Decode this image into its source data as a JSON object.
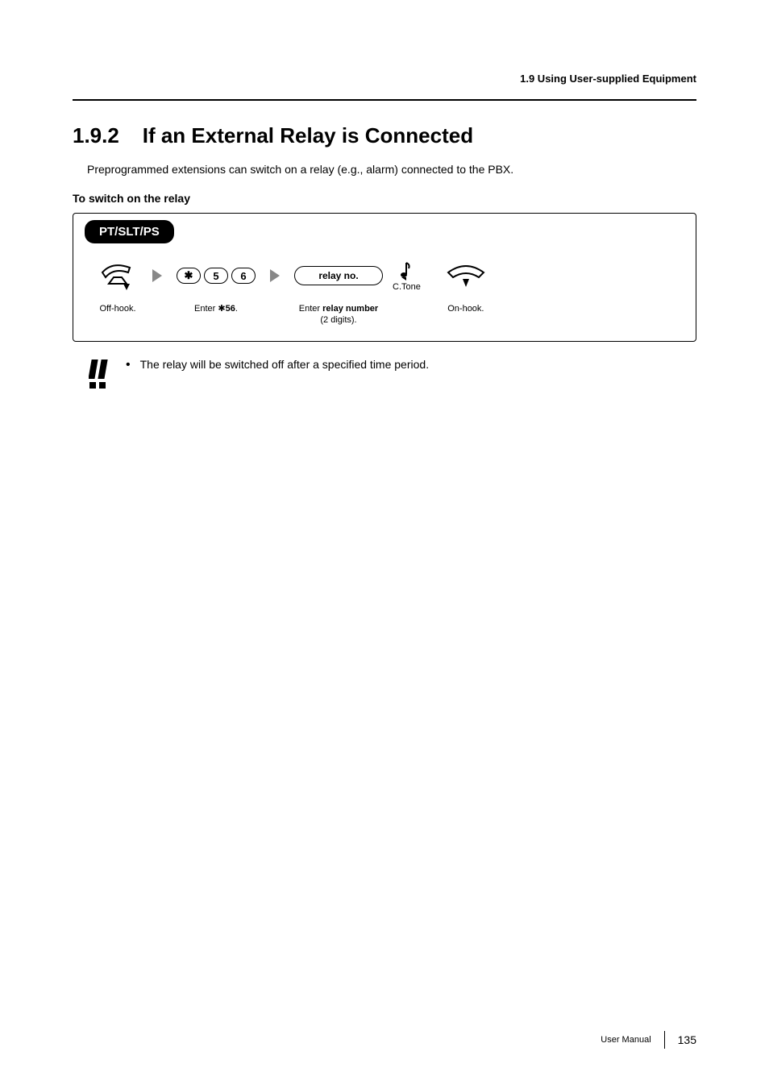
{
  "header": {
    "breadcrumb": "1.9 Using User-supplied Equipment"
  },
  "section": {
    "number": "1.9.2",
    "title": "If an External Relay is Connected"
  },
  "intro": "Preprogrammed extensions can switch on a relay (e.g., alarm) connected to the PBX.",
  "subheading": "To switch on the relay",
  "procedure": {
    "device_tab": "PT/SLT/PS",
    "steps": {
      "offhook": "Off-hook.",
      "enter_code_prefix": "Enter ",
      "enter_code_value": "56",
      "enter_code_suffix": ".",
      "keys": {
        "star": "✱",
        "k5": "5",
        "k6": "6"
      },
      "relay_pill": "relay no.",
      "relay_label_line1_prefix": "Enter ",
      "relay_label_line1_bold": "relay number",
      "relay_label_line2": "(2 digits).",
      "ctone": "C.Tone",
      "onhook": "On-hook."
    }
  },
  "note": {
    "text": "The relay will be switched off after a specified time period."
  },
  "footer": {
    "doc": "User Manual",
    "page": "135"
  }
}
